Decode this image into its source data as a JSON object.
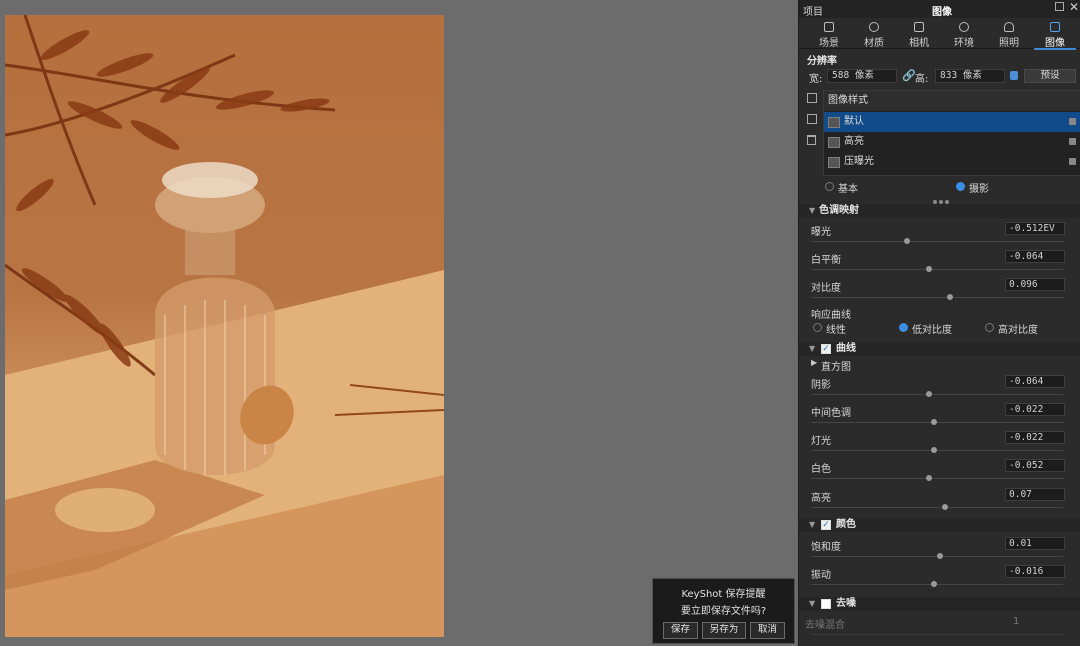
{
  "panel": {
    "title_left": "项目",
    "title_center": "图像",
    "tabs": [
      {
        "label": "场景",
        "icon": "scene-icon"
      },
      {
        "label": "材质",
        "icon": "material-icon"
      },
      {
        "label": "相机",
        "icon": "camera-icon"
      },
      {
        "label": "环境",
        "icon": "environment-icon"
      },
      {
        "label": "照明",
        "icon": "lighting-icon"
      },
      {
        "label": "图像",
        "icon": "image-icon",
        "active": true
      }
    ],
    "resolution": {
      "heading": "分辨率",
      "width_label": "宽:",
      "width_value": "588 像素",
      "height_label": "高:",
      "height_value": "833 像素",
      "preset_button": "预设"
    },
    "styles": {
      "header": "图像样式",
      "items": [
        {
          "label": "默认",
          "selected": true
        },
        {
          "label": "高亮",
          "selected": false
        },
        {
          "label": "压曝光",
          "selected": false
        }
      ]
    },
    "mode": {
      "basic": "基本",
      "photo": "摄影",
      "selected": "photo"
    },
    "tone_mapping": {
      "heading": "色调映射",
      "exposure_label": "曝光",
      "exposure_value": "-0.512EV",
      "exposure_level": 0.38,
      "white_balance_label": "白平衡",
      "white_balance_value": "-0.064",
      "white_balance_level": 0.47,
      "contrast_label": "对比度",
      "contrast_value": "0.096",
      "contrast_level": 0.55,
      "response_curve_label": "响应曲线",
      "curve_options": [
        "线性",
        "低对比度",
        "高对比度"
      ],
      "curve_selected": "低对比度"
    },
    "curves": {
      "heading": "曲线",
      "enabled": true,
      "histogram_label": "直方图",
      "shadows_label": "阴影",
      "shadows_value": "-0.064",
      "shadows_level": 0.47,
      "midtones_label": "中间色调",
      "midtones_value": "-0.022",
      "midtones_level": 0.49,
      "highlights_label": "灯光",
      "highlights_value": "-0.022",
      "highlights_level": 0.49,
      "whites_label": "白色",
      "whites_value": "-0.052",
      "whites_level": 0.47,
      "brights_label": "高亮",
      "brights_value": "0.07",
      "brights_level": 0.53
    },
    "color": {
      "heading": "颜色",
      "enabled": true,
      "saturation_label": "饱和度",
      "saturation_value": "0.01",
      "saturation_level": 0.51,
      "vibrance_label": "振动",
      "vibrance_value": "-0.016",
      "vibrance_level": 0.49
    },
    "denoise": {
      "heading": "去噪",
      "enabled": false,
      "blend_label": "去噪混合",
      "blend_value": "1"
    }
  },
  "dialog": {
    "title": "KeyShot 保存提醒",
    "message": "要立即保存文件吗?",
    "save": "保存",
    "save_as": "另存为",
    "cancel": "取消"
  },
  "colors": {
    "accent": "#3e8ad6",
    "selection": "#124b8a",
    "render_background": "#b87544"
  }
}
